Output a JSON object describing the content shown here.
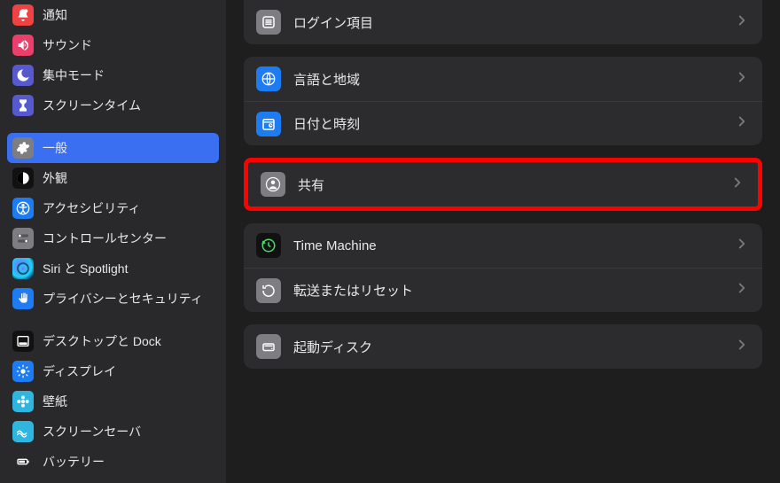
{
  "sidebar": {
    "items": [
      {
        "label": "通知",
        "icon": "bell-badge-icon",
        "bg": "bg-red"
      },
      {
        "label": "サウンド",
        "icon": "speaker-icon",
        "bg": "bg-pink"
      },
      {
        "label": "集中モード",
        "icon": "moon-icon",
        "bg": "bg-indigo"
      },
      {
        "label": "スクリーンタイム",
        "icon": "hourglass-icon",
        "bg": "bg-indigo"
      },
      {
        "label": "一般",
        "icon": "gear-icon",
        "bg": "bg-gray",
        "selected": true
      },
      {
        "label": "外観",
        "icon": "contrast-icon",
        "bg": "bg-black"
      },
      {
        "label": "アクセシビリティ",
        "icon": "accessibility-icon",
        "bg": "bg-blue"
      },
      {
        "label": "コントロールセンター",
        "icon": "switches-icon",
        "bg": "bg-gray"
      },
      {
        "label": "Siri と Spotlight",
        "icon": "siri-icon",
        "bg": "bg-siri"
      },
      {
        "label": "プライバシーとセキュリティ",
        "icon": "hand-icon",
        "bg": "bg-blue"
      },
      {
        "label": "デスクトップと Dock",
        "icon": "dock-icon",
        "bg": "bg-black"
      },
      {
        "label": "ディスプレイ",
        "icon": "brightness-icon",
        "bg": "bg-blue"
      },
      {
        "label": "壁紙",
        "icon": "flower-icon",
        "bg": "bg-cyan"
      },
      {
        "label": "スクリーンセーバ",
        "icon": "wave-icon",
        "bg": "bg-cyan"
      },
      {
        "label": "バッテリー",
        "icon": "battery-icon",
        "bg": "bg-green"
      }
    ],
    "gaps_after": [
      3,
      9
    ]
  },
  "main": {
    "rows": [
      {
        "label": "ログイン項目",
        "icon": "list-icon",
        "bg": "bg-gray",
        "group": 0
      },
      {
        "label": "言語と地域",
        "icon": "globe-icon",
        "bg": "bg-blue",
        "group": 1
      },
      {
        "label": "日付と時刻",
        "icon": "calendar-icon",
        "bg": "bg-blue",
        "group": 1
      },
      {
        "label": "共有",
        "icon": "person-icon",
        "bg": "bg-gray",
        "group": 2,
        "highlight": true
      },
      {
        "label": "Time Machine",
        "icon": "clock-back-icon",
        "bg": "bg-black",
        "group": 3
      },
      {
        "label": "転送またはリセット",
        "icon": "reset-icon",
        "bg": "bg-gray",
        "group": 3
      },
      {
        "label": "起動ディスク",
        "icon": "disk-icon",
        "bg": "bg-gray",
        "group": 4
      }
    ]
  }
}
